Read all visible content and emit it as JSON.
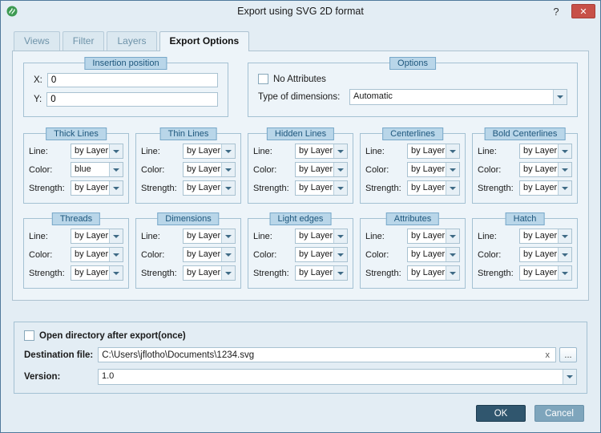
{
  "window": {
    "title": "Export using SVG 2D format",
    "help": "?",
    "close": "✕"
  },
  "tabs": [
    {
      "label": "Views"
    },
    {
      "label": "Filter"
    },
    {
      "label": "Layers"
    },
    {
      "label": "Export Options"
    }
  ],
  "insertion": {
    "title": "Insertion position",
    "x_label": "X:",
    "x_value": "0",
    "y_label": "Y:",
    "y_value": "0"
  },
  "options": {
    "title": "Options",
    "no_attributes": "No Attributes",
    "type_of_dimensions_label": "Type of dimensions:",
    "type_of_dimensions_value": "Automatic"
  },
  "labels": {
    "line": "Line:",
    "color": "Color:",
    "strength": "Strength:"
  },
  "line_groups": [
    {
      "title": "Thick Lines",
      "line": "by Layer",
      "color": "blue",
      "strength": "by Layer"
    },
    {
      "title": "Thin Lines",
      "line": "by Layer",
      "color": "by Layer",
      "strength": "by Layer"
    },
    {
      "title": "Hidden Lines",
      "line": "by Layer",
      "color": "by Layer",
      "strength": "by Layer"
    },
    {
      "title": "Centerlines",
      "line": "by Layer",
      "color": "by Layer",
      "strength": "by Layer"
    },
    {
      "title": "Bold Centerlines",
      "line": "by Layer",
      "color": "by Layer",
      "strength": "by Layer"
    },
    {
      "title": "Threads",
      "line": "by Layer",
      "color": "by Layer",
      "strength": "by Layer"
    },
    {
      "title": "Dimensions",
      "line": "by Layer",
      "color": "by Layer",
      "strength": "by Layer"
    },
    {
      "title": "Light edges",
      "line": "by Layer",
      "color": "by Layer",
      "strength": "by Layer"
    },
    {
      "title": "Attributes",
      "line": "by Layer",
      "color": "by Layer",
      "strength": "by Layer"
    },
    {
      "title": "Hatch",
      "line": "by Layer",
      "color": "by Layer",
      "strength": "by Layer"
    }
  ],
  "export_section": {
    "open_directory": "Open directory after export(once)",
    "destination_label": "Destination file:",
    "destination_value": "C:\\Users\\jflotho\\Documents\\1234.svg",
    "clear": "x",
    "browse": "...",
    "version_label": "Version:",
    "version_value": "1.0"
  },
  "footer": {
    "ok": "OK",
    "cancel": "Cancel"
  },
  "colors": {
    "group_title_bg": "#b9d6e9",
    "ok_button": "#30566e",
    "cancel_button": "#7ea5bc",
    "close_button": "#c75048"
  }
}
